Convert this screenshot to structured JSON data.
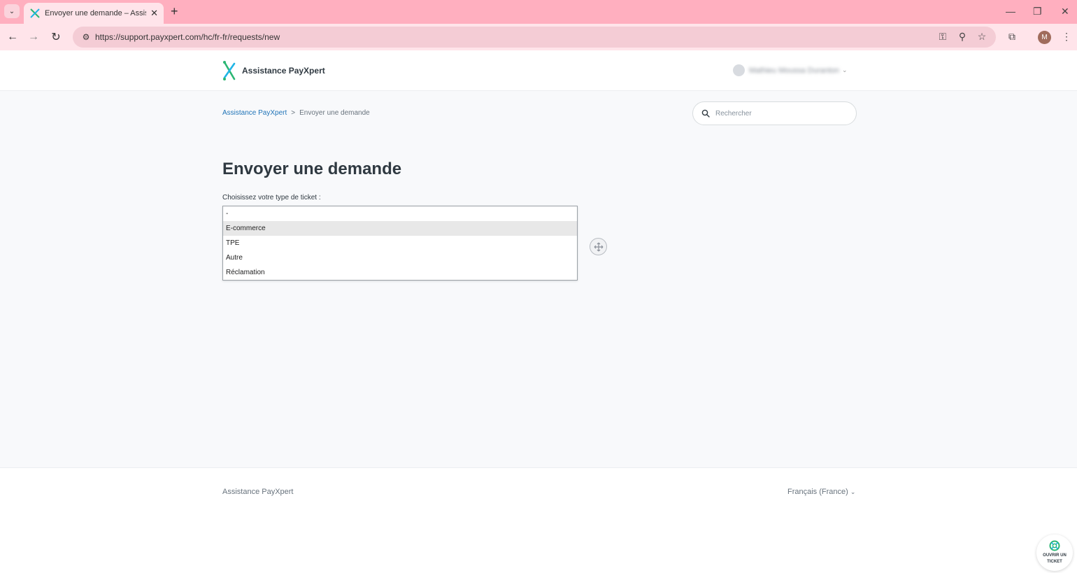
{
  "browser": {
    "tab_title": "Envoyer une demande – Assistance PayXpert",
    "url": "https://support.payxpert.com/hc/fr-fr/requests/new",
    "profile_initial": "M",
    "tabbar_color": "#ffafbf"
  },
  "header": {
    "brand": "Assistance PayXpert",
    "user_name": "Mathieu Moussa Duranton"
  },
  "breadcrumb": {
    "items": [
      {
        "label": "Assistance PayXpert"
      },
      {
        "label": "Envoyer une demande"
      }
    ],
    "separator": ">"
  },
  "search": {
    "placeholder": "Rechercher"
  },
  "main": {
    "title": "Envoyer une demande",
    "field_label": "Choisissez votre type de ticket :",
    "options": [
      "-",
      "E-commerce",
      "TPE",
      "Autre",
      "Réclamation"
    ],
    "highlighted_option": "E-commerce"
  },
  "footer": {
    "brand": "Assistance PayXpert",
    "language": "Français (France)"
  },
  "ticket_button": {
    "label": "OUVRIR UN TICKET"
  },
  "colors": {
    "link": "#1f73b7",
    "accent_green": "#2bb673",
    "accent_blue": "#1fb5e6"
  }
}
